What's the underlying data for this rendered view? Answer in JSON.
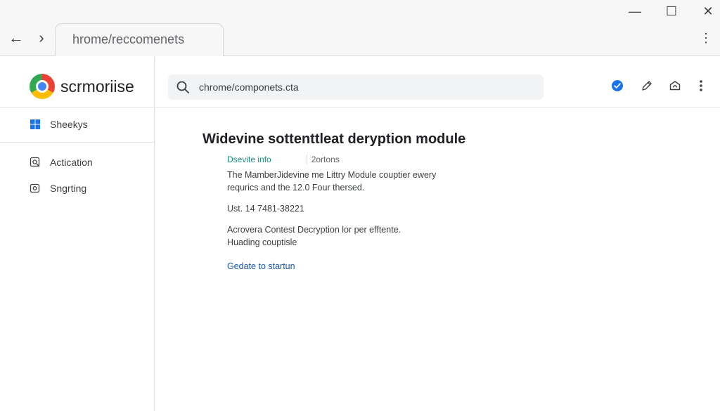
{
  "window": {
    "minimize_glyph": "—",
    "maximize_glyph": "☐",
    "close_glyph": "✕"
  },
  "nav": {
    "back_glyph": "←",
    "forward_glyph": "›",
    "menu_glyph": "⋮"
  },
  "tab": {
    "title": "hrome/reccomenets"
  },
  "sidebar": {
    "brand": "scrmoriise",
    "items": [
      {
        "label": "Sheekys",
        "icon": "windows-icon"
      },
      {
        "label": "Actication",
        "icon": "activation-icon"
      },
      {
        "label": "Sngrting",
        "icon": "settings-icon"
      }
    ]
  },
  "header": {
    "search_value": "chrome/componets.cta",
    "icons": [
      "verified-check-icon",
      "edit-pencil-icon",
      "extension-icon",
      "more-vert-icon"
    ],
    "accent_color": "#1a73e8"
  },
  "content": {
    "title": "Widevine sottenttleat deryption module",
    "meta_link": "Dsevite info",
    "meta_right": "2ortons",
    "paragraph1_line1": "The MamberJidevine me Littry Module couptier ewery",
    "paragraph1_line2": "requrics and the 12.0 Four thersed.",
    "version": "Ust. 14 7481-38221",
    "paragraph2_line1": "Acrovera Contest Decryption lor per efftente.",
    "paragraph2_line2": "Huading couptisle",
    "update_link": "Gedate to startun"
  }
}
